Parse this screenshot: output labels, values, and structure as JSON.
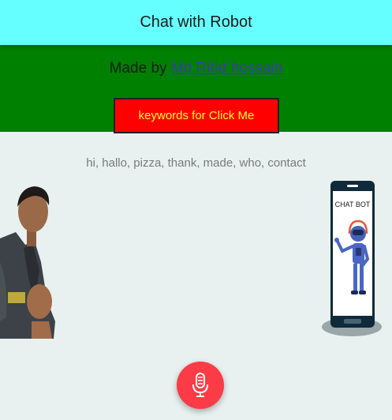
{
  "header": {
    "title": "Chat with Robot"
  },
  "credit": {
    "prefix": "Made by",
    "author": "Md Rifat hossain"
  },
  "keywords_button": {
    "label": "keywords for Click Me"
  },
  "keywords_line": {
    "text": "hi, hallo, pizza, thank, made, who, contact"
  },
  "robot_card": {
    "caption": "CHAT BOT"
  },
  "mic_button": {
    "icon": "microphone-icon"
  },
  "colors": {
    "header_bg": "#66ffff",
    "banner_bg": "#008000",
    "button_bg": "#ff0000",
    "button_text": "#ffff33",
    "page_bg": "#e8f1f0",
    "mic_bg": "#fb3b45"
  }
}
